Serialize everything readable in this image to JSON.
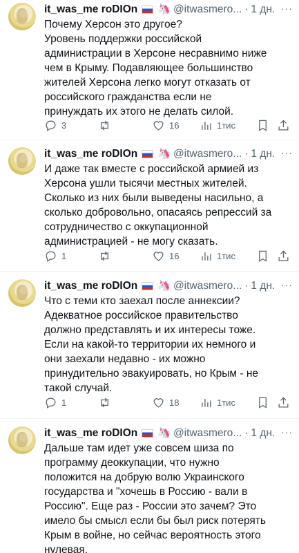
{
  "tweets": [
    {
      "name": "it_was_me roDIOn",
      "flag": "ru-flag",
      "emoji": "🦄",
      "handle": "@itwasmero...",
      "time": "1 дн.",
      "more": "···",
      "text": "Почему Херсон это другое?\nУровень поддержки российской\nадминистрации в Херсоне несравнимо ниже\nчем в Крыму. Подавляющее большинство\nжителей Херсона легко могут отказать от\nроссийского гражданства если не\nпринуждать их этого не делать силой.",
      "replies": "3",
      "retweets": "",
      "likes": "16",
      "views": "1тис"
    },
    {
      "name": "it_was_me roDIOn",
      "flag": "ru-flag",
      "emoji": "🦄",
      "handle": "@itwasmero...",
      "time": "1 дн.",
      "more": "···",
      "text": "И даже так вместе с российской армией из\nХерсона ушли тысячи местных жителей.\nСколько из них были выведены насильно, а\nсколько добровольно, опасаясь репрессий за\nсотрудничество с оккупационной\nадминистрацией - не могу сказать.",
      "replies": "1",
      "retweets": "",
      "likes": "16",
      "views": "1тис"
    },
    {
      "name": "it_was_me roDIOn",
      "flag": "ru-flag",
      "emoji": "🦄",
      "handle": "@itwasmero...",
      "time": "1 дн.",
      "more": "···",
      "text": "Что с теми кто заехал после аннексии?\nАдекватное российское правительство\nдолжно представлять и их интересы тоже.\nЕсли на какой-то территории их немного и\nони заехали недавно - их можно\nпринудительно эвакуировать, но Крым - не\nтакой случай.",
      "replies": "1",
      "retweets": "",
      "likes": "18",
      "views": "1тис"
    },
    {
      "name": "it_was_me roDIOn",
      "flag": "ru-flag",
      "emoji": "🦄",
      "handle": "@itwasmero...",
      "time": "1 дн.",
      "more": "···",
      "text": "Дальше там идет уже совсем шиза по\nпрограмму деоккупации, что нужно\nположится на добрую волю Украинского\nгосударства и \"хочешь в Россию - вали в\nРоссию\". Еще раз - России это зачем? Это\nимело бы смысл если бы был риск потерять\nКрым в войне, но сейчас вероятность этого\nнулевая.",
      "replies": "",
      "retweets": "",
      "likes": "",
      "views": ""
    }
  ],
  "icons": {
    "reply": "reply-icon",
    "retweet": "retweet-icon",
    "like": "heart-icon",
    "views": "views-icon",
    "bookmark": "bookmark-icon",
    "share": "share-icon"
  },
  "colors": {
    "text": "#0f1419",
    "secondary": "#536471",
    "separator": "#eff3f4"
  }
}
